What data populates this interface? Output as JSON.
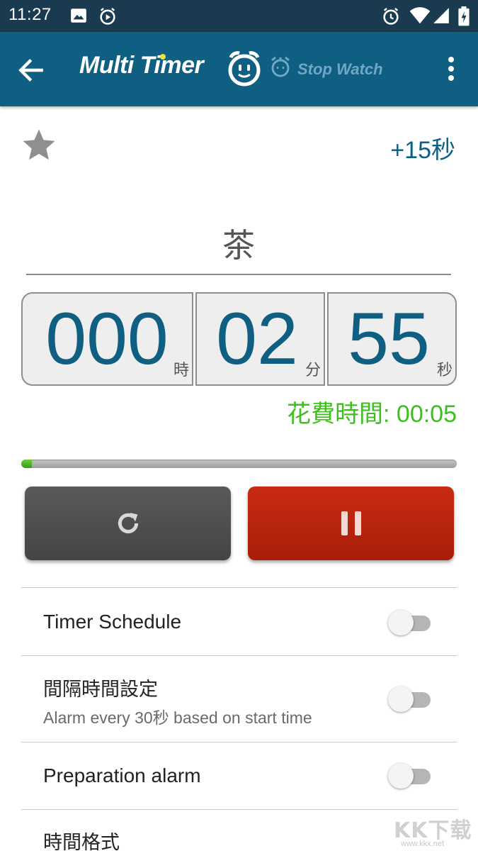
{
  "status_bar": {
    "time": "11:27",
    "icons": [
      "image-icon",
      "play-circle-icon",
      "alarm-icon",
      "wifi-icon",
      "signal-icon",
      "battery-icon"
    ]
  },
  "app_bar": {
    "title": "Multi Timer",
    "stopwatch_label": "Stop Watch",
    "background_color": "#0f5f82",
    "logo_accent_color": "#e9e13a"
  },
  "timer": {
    "add_time_label": "+15秒",
    "name": "茶",
    "hours": "000",
    "minutes": "02",
    "seconds": "55",
    "hours_unit": "時",
    "minutes_unit": "分",
    "seconds_unit": "秒",
    "elapsed": "花費時間: 00:05",
    "progress_fraction": 0.025,
    "digit_color": "#0f5f82",
    "elapsed_color": "#3fbf1f"
  },
  "buttons": {
    "reset_icon": "refresh-icon",
    "pause_icon": "pause-icon",
    "pause_color": "#c02a0f"
  },
  "settings": [
    {
      "title": "Timer Schedule",
      "subtitle": "",
      "enabled": false
    },
    {
      "title": "間隔時間設定",
      "subtitle": "Alarm every 30秒 based on start time",
      "enabled": false
    },
    {
      "title": "Preparation alarm",
      "subtitle": "",
      "enabled": false
    },
    {
      "title": "時間格式",
      "subtitle": "",
      "enabled": false
    }
  ],
  "watermark": {
    "brand": "KK下载",
    "url": "www.kkx.net"
  }
}
